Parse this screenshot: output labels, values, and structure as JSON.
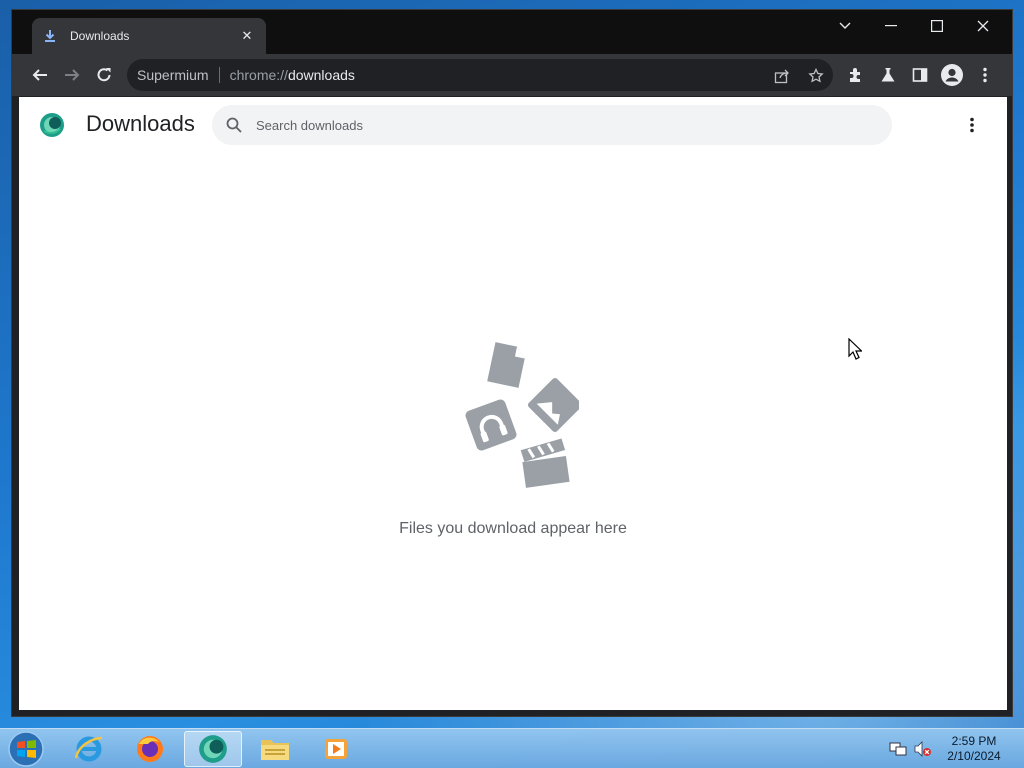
{
  "tab": {
    "title": "Downloads",
    "close_glyph": "✕"
  },
  "window_controls": {
    "dropdown": "tab-search-icon",
    "minimize": "minimize-icon",
    "maximize": "maximize-icon",
    "close": "close-icon"
  },
  "omnibox": {
    "site_label": "Supermium",
    "scheme": "chrome://",
    "host": "downloads"
  },
  "page": {
    "title": "Downloads",
    "search_placeholder": "Search downloads",
    "empty_message": "Files you download appear here"
  },
  "taskbar": {
    "apps": [
      "internet-explorer-icon",
      "firefox-icon",
      "supermium-icon",
      "file-explorer-icon",
      "media-player-icon"
    ],
    "clock_time": "2:59 PM",
    "clock_date": "2/10/2024"
  },
  "colors": {
    "accent": "#1a73e8",
    "toolbar": "#35363a",
    "tabstrip": "#0f0f10",
    "illustration": "#9aa0a6"
  }
}
